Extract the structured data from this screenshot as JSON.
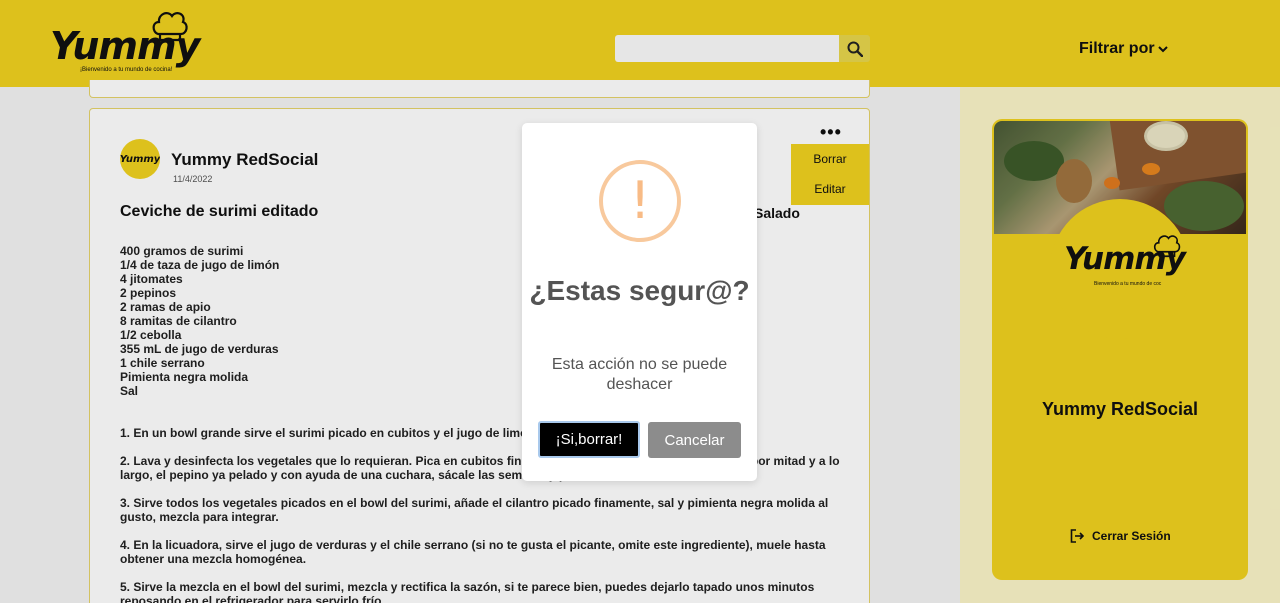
{
  "header": {
    "logo_text": "Yummy",
    "logo_tagline": "¡Bienvenido a tu mundo de cocina!",
    "search_placeholder": "",
    "filter_label": "Filtrar por"
  },
  "post": {
    "author": "Yummy RedSocial",
    "avatar_text": "Yummy",
    "date": "11/4/2022",
    "menu_items": [
      "Borrar",
      "Editar"
    ],
    "title": "Ceviche de surimi editado",
    "category": "Salado",
    "ingredients": [
      "400 gramos de surimi",
      "1/4 de taza de jugo de limón",
      "4 jitomates",
      "2 pepinos",
      "2 ramas de apio",
      "8 ramitas de cilantro",
      "1/2 cebolla",
      "355 mL de jugo de verduras",
      "1 chile serrano",
      "Pimienta negra molida",
      "Sal"
    ],
    "steps": [
      "1. En un bowl grande sirve el surimi picado en cubitos y el jugo de limón",
      "2. Lava y desinfecta los vegetales que lo requieran. Pica en cubitos finos el jitomate, el apio y la cebolla. Parte por mitad y a lo largo, el pepino ya pelado y con ayuda de una cuchara, sácale las semillas y pícalo en cubitos finos.",
      "3. Sirve todos los vegetales picados en el bowl del surimi, añade el cilantro picado finamente, sal y pimienta negra molida al gusto, mezcla para integrar.",
      "4. En la licuadora, sirve el jugo de verduras y el chile serrano (si no te gusta el picante, omite este ingrediente), muele hasta obtener una mezcla homogénea.",
      "5. Sirve la mezcla en el bowl del surimi, mezcla y rectifica la sazón, si te parece bien, puedes dejarlo tapado unos minutos reposando en el refrigerador para servirlo frío."
    ]
  },
  "sidebar": {
    "logo_text": "Yummy",
    "logo_tagline": "Bienvenido a tu mundo de coc",
    "profile_name": "Yummy RedSocial",
    "logout_label": "Cerrar Sesión"
  },
  "modal": {
    "icon": "!",
    "title": "¿Estas segur@?",
    "text": "Esta acción no se puede deshacer",
    "confirm_label": "¡Si,borrar!",
    "cancel_label": "Cancelar"
  },
  "colors": {
    "brand_yellow": "#f0d21f",
    "sidebar_bg": "#fbf5c8",
    "warning_orange": "#f8bb86",
    "cancel_gray": "#8c8c8c"
  }
}
